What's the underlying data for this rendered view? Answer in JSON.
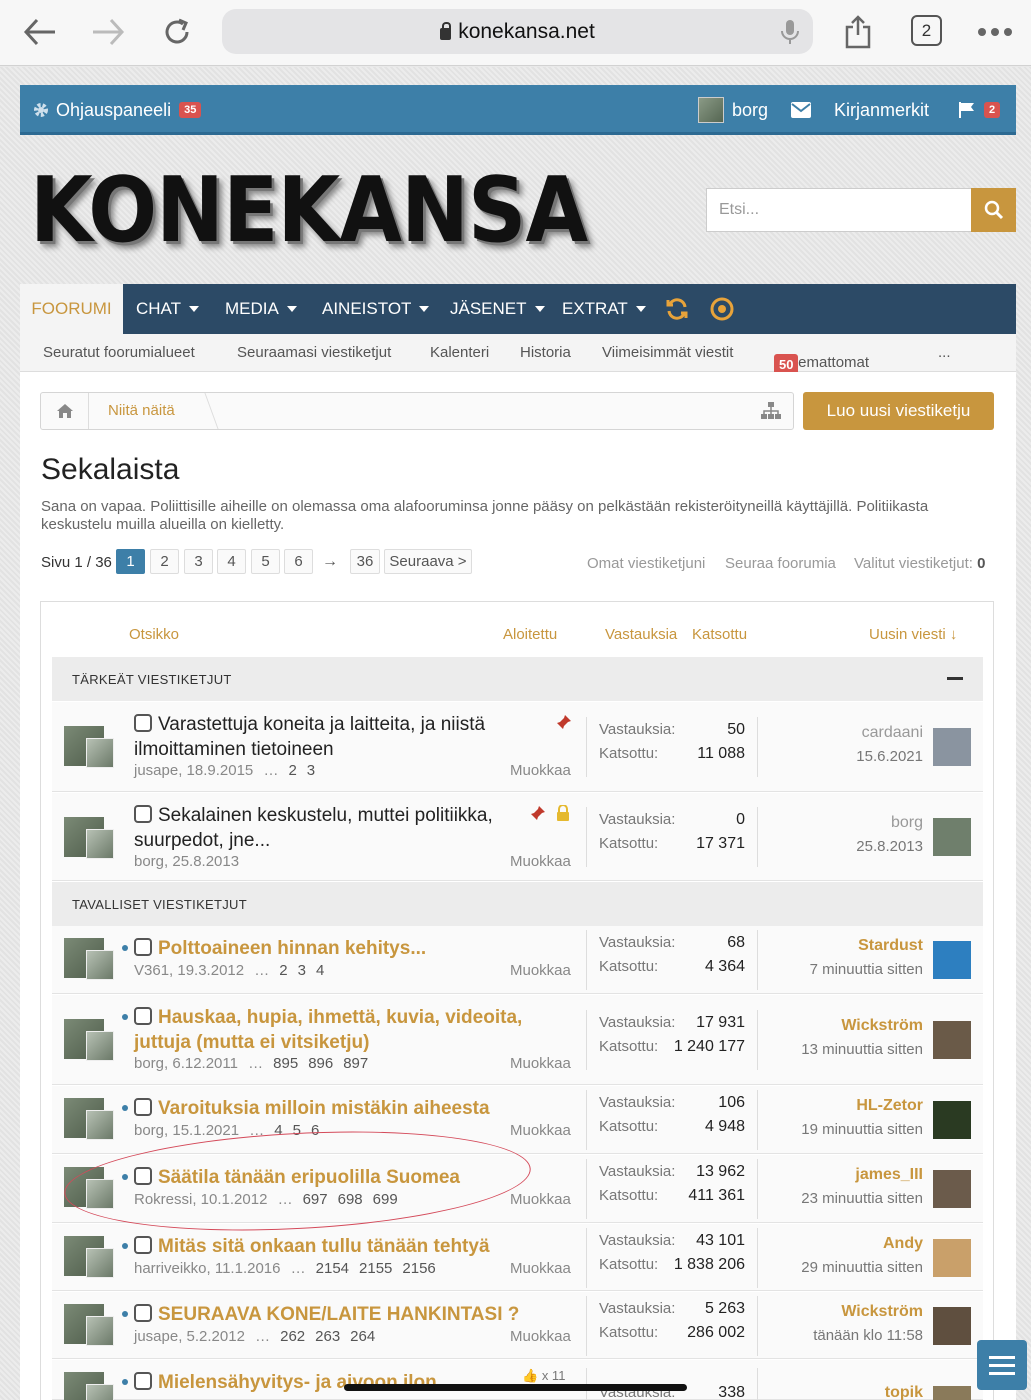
{
  "browser": {
    "url": "konekansa.net",
    "tab_count": "2"
  },
  "userbar": {
    "control_panel": "Ohjauspaneeli",
    "control_panel_badge": "35",
    "username": "borg",
    "bookmarks": "Kirjanmerkit",
    "alerts_badge": "2"
  },
  "logo": "KONEKANSA",
  "search": {
    "placeholder": "Etsi..."
  },
  "nav": {
    "tabs": [
      "FOORUMI",
      "CHAT",
      "MEDIA",
      "AINEISTOT",
      "JÄSENET",
      "EXTRAT"
    ],
    "sub": [
      "Seuratut foorumialueet",
      "Seuraamasi viestiketjut",
      "Kalenteri",
      "Historia",
      "Viimeisimmät viestit",
      "Lukemattomat"
    ],
    "unread_badge": "50",
    "more": "..."
  },
  "breadcrumb": {
    "item": "Niitä näitä"
  },
  "new_thread_button": "Luo uusi viestiketju",
  "forum": {
    "title": "Sekalaista",
    "description": "Sana on vapaa. Poliittisille aiheille on olemassa oma alafooruminsa jonne pääsy on pelkästään rekisteröityneillä käyttäjillä. Politiikasta keskustelu muilla alueilla on kielletty."
  },
  "pager": {
    "label": "Sivu 1 / 36",
    "pages": [
      "1",
      "2",
      "3",
      "4",
      "5",
      "6"
    ],
    "arrow": "→",
    "last": "36",
    "next": "Seuraava >",
    "my_threads": "Omat viestiketjuni",
    "follow": "Seuraa foorumia",
    "selected_label": "Valitut viestiketjut:",
    "selected_count": "0"
  },
  "table": {
    "col_title": "Otsikko",
    "col_started": "Aloitettu",
    "col_replies": "Vastauksia",
    "col_views": "Katsottu",
    "col_latest": "Uusin viesti ↓",
    "sticky_header": "TÄRKEÄT VIESTIKETJUT",
    "normal_header": "TAVALLISET VIESTIKETJUT",
    "replies_label": "Vastauksia:",
    "views_label": "Katsottu:",
    "edit_label": "Muokkaa"
  },
  "sticky_threads": [
    {
      "title_line1": "Varastettuja koneita ja laitteita, ja niistä",
      "title_line2": "ilmoittaminen tietoineen",
      "author": "jusape, 18.9.2015",
      "pages": [
        "2",
        "3"
      ],
      "replies": "50",
      "views": "11 088",
      "last_user": "cardaani",
      "last_time": "15.6.2021"
    },
    {
      "title_line1": "Sekalainen keskustelu, muttei politiikka,",
      "title_line2": "suurpedot, jne...",
      "author": "borg, 25.8.2013",
      "pages": [],
      "replies": "0",
      "views": "17 371",
      "last_user": "borg",
      "last_time": "25.8.2013"
    }
  ],
  "threads": [
    {
      "title_line1": "Polttoaineen hinnan kehitys...",
      "title_line2": "",
      "author": "V361, 19.3.2012",
      "pages": [
        "2",
        "3",
        "4"
      ],
      "replies": "68",
      "views": "4 364",
      "last_user": "Stardust",
      "last_time": "7 minuuttia sitten"
    },
    {
      "title_line1": "Hauskaa, hupia, ihmettä, kuvia, videoita,",
      "title_line2": "juttuja (mutta ei vitsiketju)",
      "author": "borg, 6.12.2011",
      "pages": [
        "895",
        "896",
        "897"
      ],
      "replies": "17 931",
      "views": "1 240 177",
      "last_user": "Wickström",
      "last_time": "13 minuuttia sitten"
    },
    {
      "title_line1": "Varoituksia milloin mistäkin aiheesta",
      "title_line2": "",
      "author": "borg, 15.1.2021",
      "pages": [
        "4",
        "5",
        "6"
      ],
      "replies": "106",
      "views": "4 948",
      "last_user": "HL-Zetor",
      "last_time": "19 minuuttia sitten"
    },
    {
      "title_line1": "Säätila tänään eripuolilla Suomea",
      "title_line2": "",
      "author": "Rokressi, 10.1.2012",
      "pages": [
        "697",
        "698",
        "699"
      ],
      "replies": "13 962",
      "views": "411 361",
      "last_user": "james_III",
      "last_time": "23 minuuttia sitten"
    },
    {
      "title_line1": "Mitäs sitä onkaan tullu tänään tehtyä",
      "title_line2": "",
      "author": "harriveikko, 11.1.2016",
      "pages": [
        "2154",
        "2155",
        "2156"
      ],
      "replies": "43 101",
      "views": "1 838 206",
      "last_user": "Andy",
      "last_time": "29 minuuttia sitten"
    },
    {
      "title_line1": "SEURAAVA KONE/LAITE HANKINTASI ?",
      "title_line2": "",
      "author": "jusape, 5.2.2012",
      "pages": [
        "262",
        "263",
        "264"
      ],
      "replies": "5 263",
      "views": "286 002",
      "last_user": "Wickström",
      "last_time": "tänään klo 11:58"
    },
    {
      "title_line1": "Mielensähyvitys- ja aivoon ilon",
      "title_line2": "",
      "author": "",
      "pages": [],
      "replies": "338",
      "views": "",
      "last_user": "topik",
      "last_time": "",
      "likes": "x 11"
    }
  ],
  "colors": {
    "accent": "#c8963e",
    "blue": "#3d7fa8",
    "nav": "#2c4a66"
  }
}
